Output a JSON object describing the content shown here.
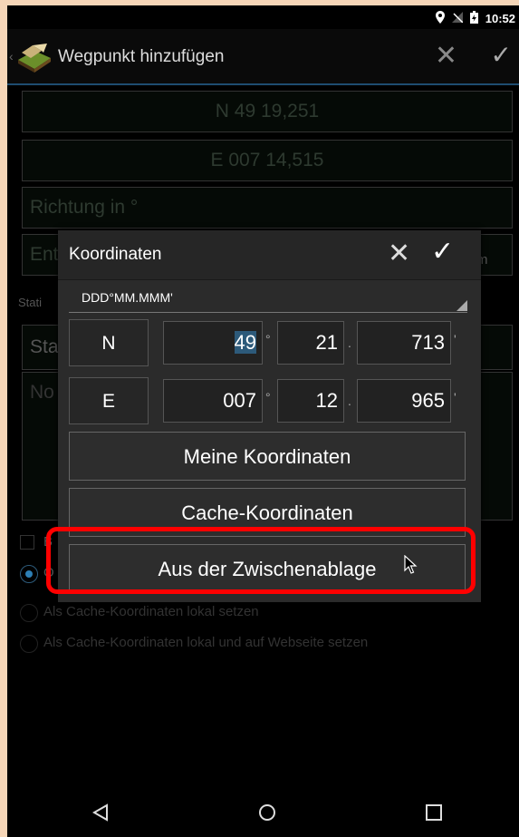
{
  "status": {
    "time": "10:52"
  },
  "actionbar": {
    "title": "Wegpunkt hinzufügen"
  },
  "background": {
    "lat": "N 49 19,251",
    "lon": "E 007 14,515",
    "direction_placeholder": "Richtung in °",
    "distance_placeholder": "Ent",
    "distance_unit": "m",
    "section_label": "Stati",
    "type_field": "Sta",
    "note_field": "No",
    "checkbox_letter": "B",
    "radio_1_letter": "O",
    "radio_2": "Als Cache-Koordinaten lokal setzen",
    "radio_3": "Als Cache-Koordinaten lokal und auf Webseite setzen"
  },
  "dialog": {
    "title": "Koordinaten",
    "format": "DDD°MM.MMM'",
    "north": {
      "hemi": "N",
      "deg": "49",
      "min": "21",
      "frac": "713"
    },
    "east": {
      "hemi": "E",
      "deg": "007",
      "min": "12",
      "frac": "965"
    },
    "deg_sym": "°",
    "dot": ".",
    "apos": "'",
    "btn_my": "Meine Koordinaten",
    "btn_cache": "Cache-Koordinaten",
    "btn_clipboard": "Aus der Zwischenablage"
  },
  "colors": {
    "accent": "#2d5a7a",
    "highlight": "#ff0000"
  }
}
